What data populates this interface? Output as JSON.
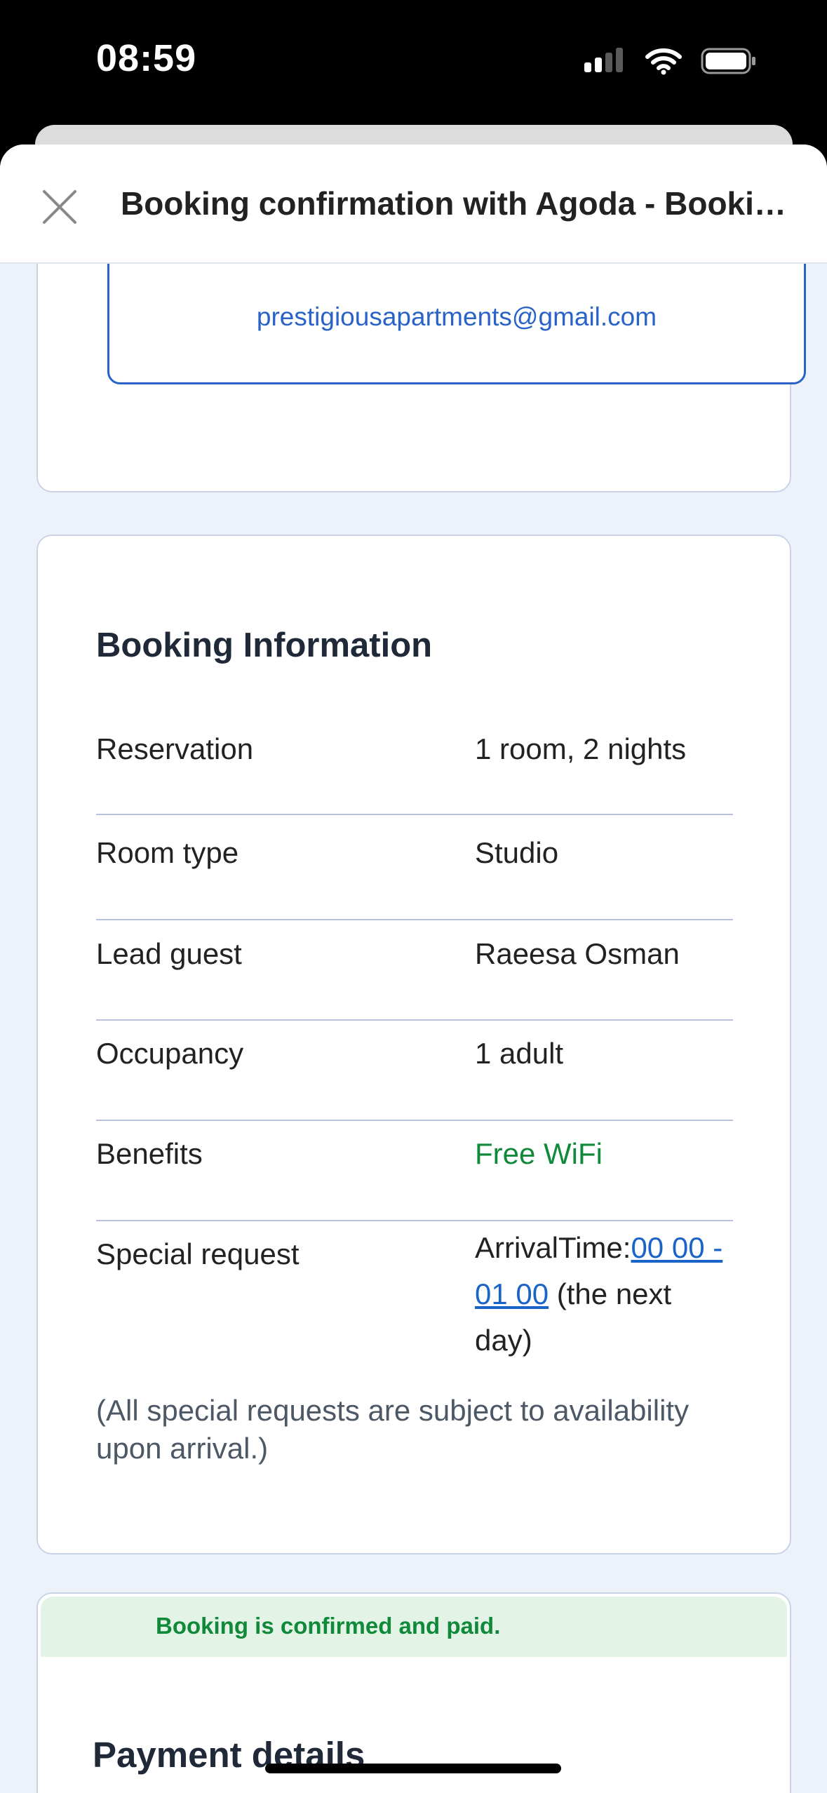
{
  "status_bar": {
    "time": "08:59",
    "icons": [
      "cellular-signal-icon",
      "wifi-icon",
      "battery-icon"
    ]
  },
  "header": {
    "title": "Booking confirmation with Agoda - Booking ID: ...",
    "close_icon": "close-icon"
  },
  "contact": {
    "email": "prestigiousapartments@gmail.com"
  },
  "booking_info": {
    "title": "Booking Information",
    "rows": [
      {
        "label": "Reservation",
        "value": "1 room, 2 nights"
      },
      {
        "label": "Room type",
        "value": "Studio"
      },
      {
        "label": "Lead guest",
        "value": "Raeesa Osman"
      },
      {
        "label": "Occupancy",
        "value": "1 adult"
      },
      {
        "label": "Benefits",
        "value": "Free WiFi"
      }
    ],
    "special_request": {
      "label": "Special request",
      "prefix": "ArrivalTime:",
      "link": "00 00 - 01 00",
      "suffix": " (the next day)"
    },
    "disclaimer": "(All special requests are subject to availability upon arrival.)"
  },
  "payment": {
    "banner": "Booking is confirmed and paid.",
    "title": "Payment details"
  },
  "colors": {
    "link_blue": "#2a63c8",
    "success_green": "#108a3a",
    "page_background": "#edf2fa"
  }
}
